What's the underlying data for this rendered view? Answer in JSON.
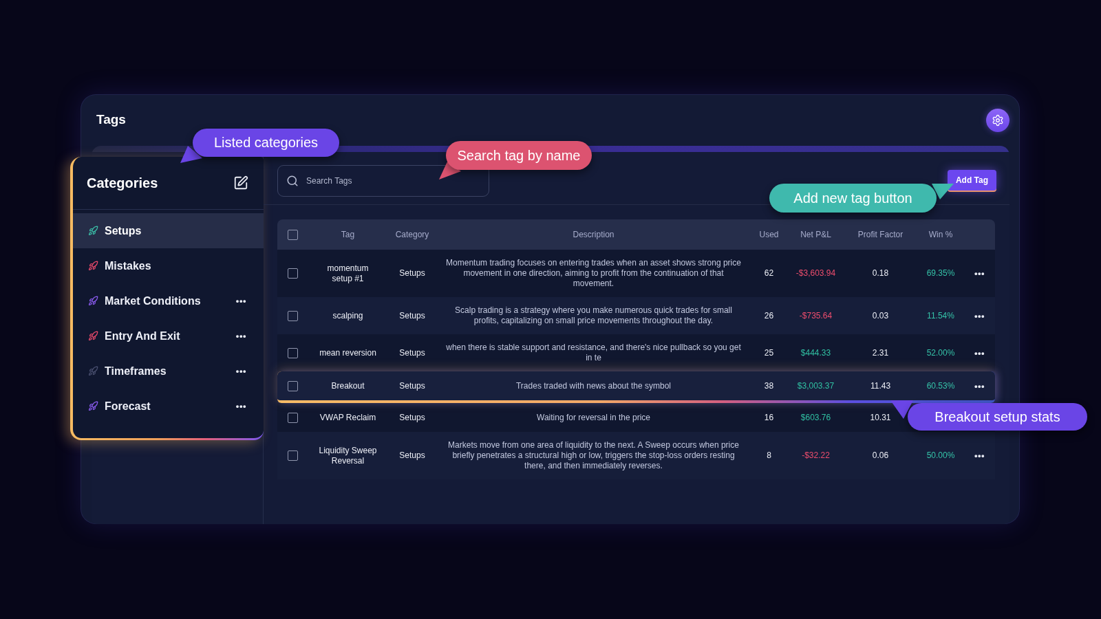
{
  "page": {
    "title": "Tags"
  },
  "categories": {
    "title": "Categories",
    "items": [
      {
        "label": "Setups",
        "selected": true,
        "color": "#3bbfa8"
      },
      {
        "label": "Mistakes",
        "selected": false,
        "color": "#e9496b"
      },
      {
        "label": "Market Conditions",
        "selected": false,
        "color": "#8b5cf0",
        "menu": "•••"
      },
      {
        "label": "Entry And Exit",
        "selected": false,
        "color": "#e9496b",
        "menu": "•••"
      },
      {
        "label": "Timeframes",
        "selected": false,
        "color": "#4a5070",
        "menu": "•••"
      },
      {
        "label": "Forecast",
        "selected": false,
        "color": "#8b5cf0",
        "menu": "•••"
      }
    ]
  },
  "search": {
    "placeholder": "Search Tags"
  },
  "add_button": {
    "label": "Add Tag"
  },
  "table": {
    "all_checked": false,
    "columns": [
      "Tag",
      "Category",
      "Description",
      "Used",
      "Net P&L",
      "Profit Factor",
      "Win %"
    ],
    "rows": [
      {
        "checked": false,
        "highlighted": false,
        "tag": "momentum setup #1",
        "category": "Setups",
        "description": "Momentum trading focuses on entering trades when an asset shows strong price movement in one direction, aiming to profit from the continuation of that movement.",
        "used": "62",
        "net_pnl": "-$3,603.94",
        "gain": false,
        "profit_factor": "0.18",
        "win_rate": "69.35%",
        "menu": "•••"
      },
      {
        "checked": false,
        "highlighted": false,
        "tag": "scalping",
        "category": "Setups",
        "description": "Scalp trading is a strategy where you make numerous quick trades for small profits, capitalizing on small price movements throughout the day.",
        "used": "26",
        "net_pnl": "-$735.64",
        "gain": false,
        "profit_factor": "0.03",
        "win_rate": "11.54%",
        "menu": "•••"
      },
      {
        "checked": false,
        "highlighted": false,
        "tag": "mean reversion",
        "category": "Setups",
        "description": "when there is stable support and resistance, and there's nice pullback so you get in te",
        "used": "25",
        "net_pnl": "$444.33",
        "gain": true,
        "profit_factor": "2.31",
        "win_rate": "52.00%",
        "menu": "•••"
      },
      {
        "checked": false,
        "highlighted": true,
        "tag": "Breakout",
        "category": "Setups",
        "description": "Trades traded with news about the symbol",
        "used": "38",
        "net_pnl": "$3,003.37",
        "gain": true,
        "profit_factor": "11.43",
        "win_rate": "60.53%",
        "menu": "•••"
      },
      {
        "checked": false,
        "highlighted": false,
        "tag": "VWAP Reclaim",
        "category": "Setups",
        "description": "Waiting for reversal in the price",
        "used": "16",
        "net_pnl": "$603.76",
        "gain": true,
        "profit_factor": "10.31"
      },
      {
        "checked": false,
        "highlighted": false,
        "tag": "Liquidity Sweep Reversal",
        "category": "Setups",
        "description": "Markets move from one area of liquidity to the next. A Sweep occurs when price briefly penetrates a structural high or low, triggers the stop-loss orders resting there, and then immediately reverses.",
        "used": "8",
        "net_pnl": "-$32.22",
        "gain": false,
        "profit_factor": "0.06",
        "win_rate": "50.00%",
        "menu": "•••"
      }
    ]
  },
  "callouts": [
    {
      "text": "Listed categories",
      "color": "#6a45e6"
    },
    {
      "text": "Search tag by name",
      "color": "#dc5370"
    },
    {
      "text": "Add new tag button",
      "color": "#3fb9ad"
    },
    {
      "text": "Breakout setup stats",
      "color": "#6a45e6"
    }
  ]
}
